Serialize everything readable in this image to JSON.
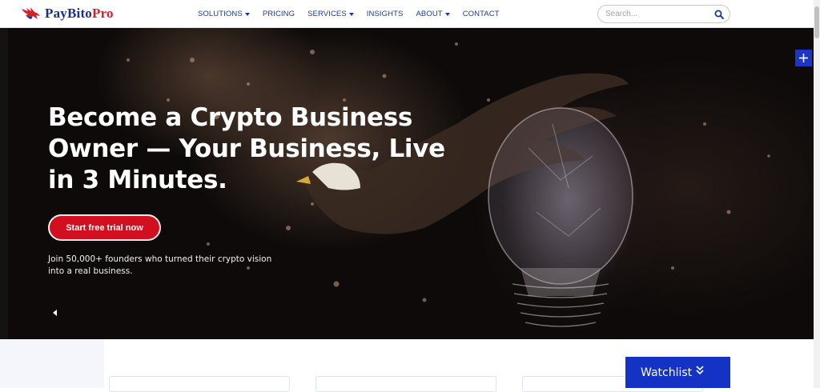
{
  "brand": {
    "name_part1": "PayBito",
    "name_part2": "Pro"
  },
  "nav": {
    "items": [
      {
        "label": "SOLUTIONS",
        "dropdown": true
      },
      {
        "label": "PRICING",
        "dropdown": false
      },
      {
        "label": "SERVICES",
        "dropdown": true
      },
      {
        "label": "INSIGHTS",
        "dropdown": false
      },
      {
        "label": "ABOUT",
        "dropdown": true
      },
      {
        "label": "CONTACT",
        "dropdown": false
      }
    ]
  },
  "search": {
    "placeholder": "Search...",
    "value": ""
  },
  "hero": {
    "title": "Become a Crypto Business Owner — Your Business, Live in 3 Minutes.",
    "cta_label": "Start free trial now",
    "subtitle": "Join 50,000+ founders who turned their crypto vision into a real business."
  },
  "watchlist": {
    "label": "Watchlist"
  },
  "icons": {
    "search": "search-icon",
    "plus": "plus-icon",
    "prev": "chevron-left-icon",
    "watchlist_toggle": "double-chevron-down-icon"
  },
  "colors": {
    "brand_blue": "#1a2f8a",
    "brand_red": "#d42128",
    "nav_text": "#1a3a9a",
    "cta": "#d10f1f",
    "watchlist_bg": "#1433c4",
    "plus_bg": "#1b35c4"
  }
}
